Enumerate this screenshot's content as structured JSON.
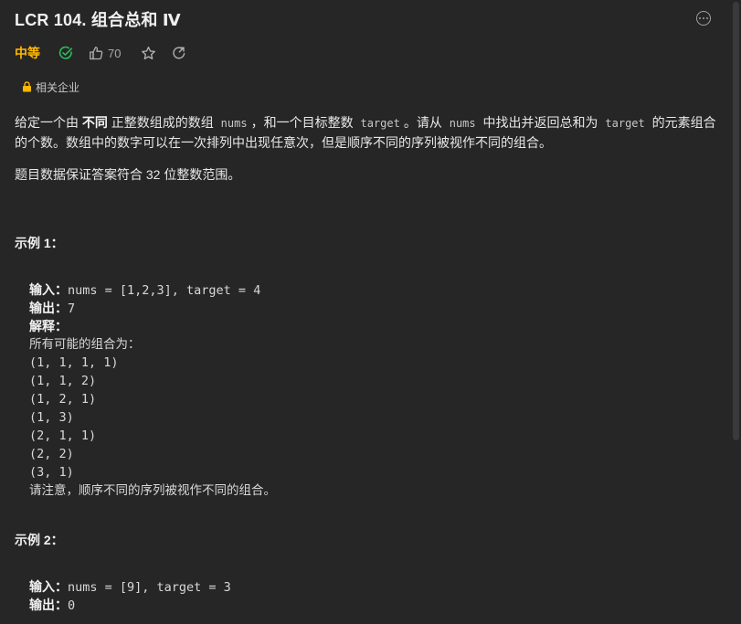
{
  "header": {
    "title": "LCR 104. 组合总和 Ⅳ"
  },
  "meta": {
    "difficulty": "中等",
    "like_count": "70"
  },
  "company": {
    "label": "相关企业"
  },
  "description": {
    "p1_a": "给定一个由 ",
    "p1_b": "不同",
    "p1_c": " 正整数组成的数组 ",
    "p1_code1": "nums",
    "p1_d": "，和一个目标整数 ",
    "p1_code2": "target",
    "p1_e": "。请从 ",
    "p1_code3": "nums",
    "p1_f": " 中找出并返回总和为 ",
    "p1_code4": "target",
    "p1_g": " 的元素组合的个数。数组中的数字可以在一次排列中出现任意次，但是顺序不同的序列被视作不同的组合。",
    "p2": "题目数据保证答案符合 32 位整数范围。"
  },
  "example1": {
    "title": "示例 1：",
    "input_label": "输入：",
    "input_value": "nums = [1,2,3], target = 4",
    "output_label": "输出：",
    "output_value": "7",
    "explain_label": "解释：",
    "explain_intro": "所有可能的组合为：",
    "combos": [
      "(1, 1, 1, 1)",
      "(1, 1, 2)",
      "(1, 2, 1)",
      "(1, 3)",
      "(2, 1, 1)",
      "(2, 2)",
      "(3, 1)"
    ],
    "note": "请注意，顺序不同的序列被视作不同的组合。"
  },
  "example2": {
    "title": "示例 2：",
    "input_label": "输入：",
    "input_value": "nums = [9], target = 3",
    "output_label": "输出：",
    "output_value": "0"
  },
  "colors": {
    "background": "#262626",
    "difficulty": "#ffb800",
    "solved": "#2cbb5d",
    "text": "#e8e8e8"
  },
  "icons": {
    "more": "more-icon",
    "solved": "check-circle-icon",
    "like": "thumb-up-icon",
    "favorite": "star-icon",
    "share": "share-icon",
    "company": "lock-icon"
  }
}
